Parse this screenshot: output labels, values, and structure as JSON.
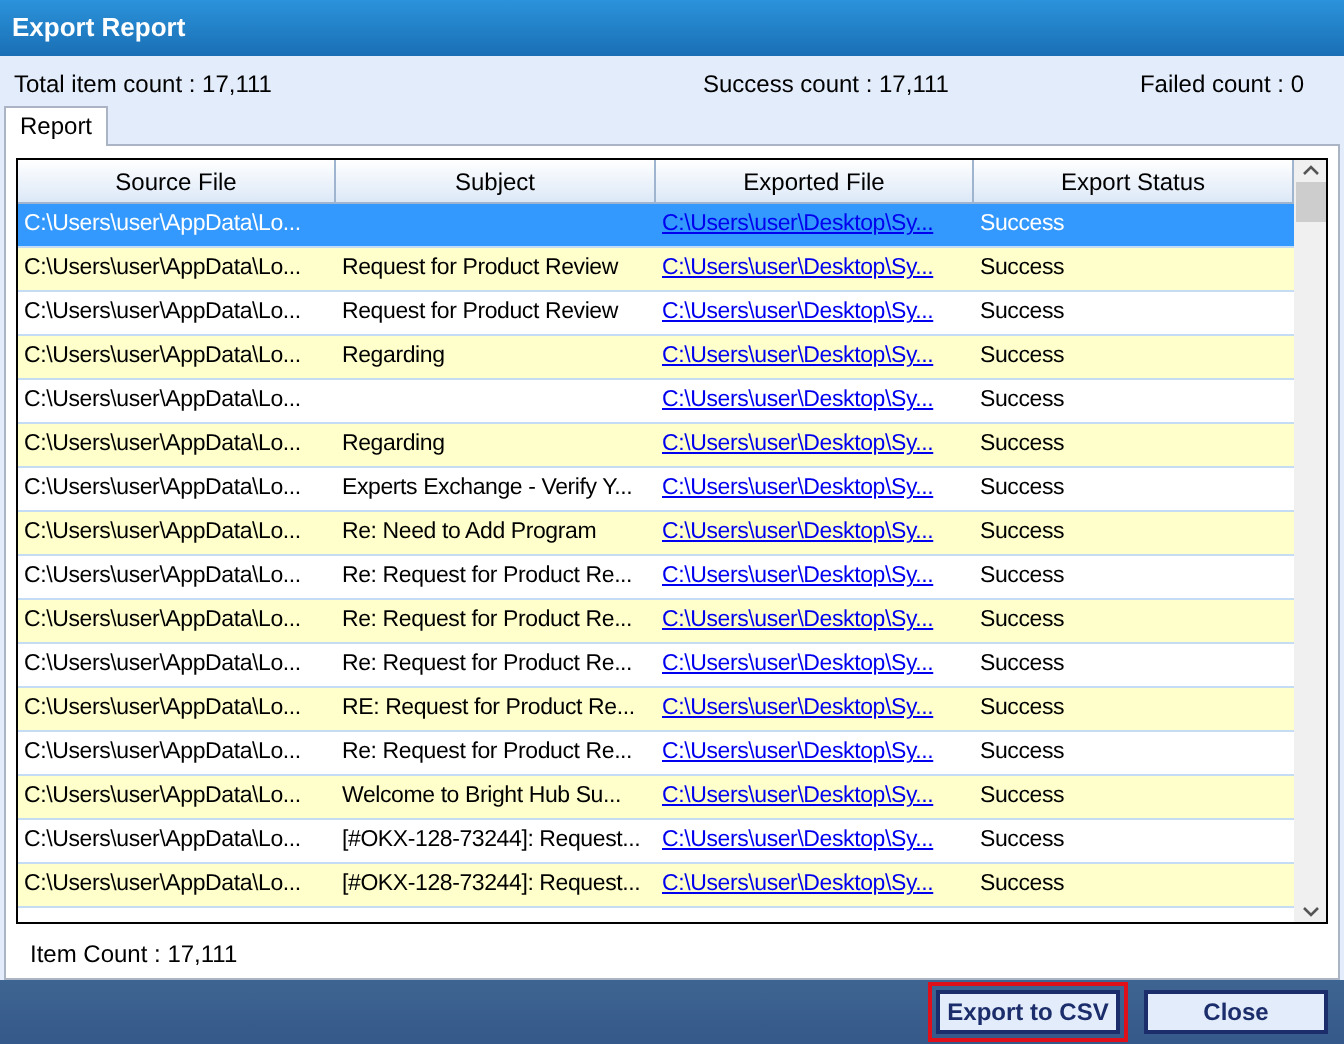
{
  "window": {
    "title": "Export Report"
  },
  "summary": {
    "total": "Total item count : 17,111",
    "success": "Success count :  17,111",
    "failed": "Failed count : 0"
  },
  "tabs": [
    {
      "label": "Report",
      "selected": true
    }
  ],
  "table": {
    "columns": [
      "Source File",
      "Subject",
      "Exported File",
      "Export Status"
    ],
    "rows": [
      {
        "source": "C:\\Users\\user\\AppData\\Lo...",
        "subject": "",
        "exported": "C:\\Users\\user\\Desktop\\Sy...",
        "status": "Success",
        "selected": true
      },
      {
        "source": "C:\\Users\\user\\AppData\\Lo...",
        "subject": "Request for Product Review",
        "exported": "C:\\Users\\user\\Desktop\\Sy...",
        "status": "Success",
        "selected": false
      },
      {
        "source": "C:\\Users\\user\\AppData\\Lo...",
        "subject": "Request for Product Review",
        "exported": "C:\\Users\\user\\Desktop\\Sy...",
        "status": "Success",
        "selected": false
      },
      {
        "source": "C:\\Users\\user\\AppData\\Lo...",
        "subject": "Regarding",
        "exported": "C:\\Users\\user\\Desktop\\Sy...",
        "status": "Success",
        "selected": false
      },
      {
        "source": "C:\\Users\\user\\AppData\\Lo...",
        "subject": "",
        "exported": "C:\\Users\\user\\Desktop\\Sy...",
        "status": "Success",
        "selected": false
      },
      {
        "source": "C:\\Users\\user\\AppData\\Lo...",
        "subject": "Regarding",
        "exported": "C:\\Users\\user\\Desktop\\Sy...",
        "status": "Success",
        "selected": false
      },
      {
        "source": "C:\\Users\\user\\AppData\\Lo...",
        "subject": "Experts Exchange - Verify Y...",
        "exported": "C:\\Users\\user\\Desktop\\Sy...",
        "status": "Success",
        "selected": false
      },
      {
        "source": "C:\\Users\\user\\AppData\\Lo...",
        "subject": "Re: Need to Add Program",
        "exported": "C:\\Users\\user\\Desktop\\Sy...",
        "status": "Success",
        "selected": false
      },
      {
        "source": "C:\\Users\\user\\AppData\\Lo...",
        "subject": "Re: Request for Product Re...",
        "exported": "C:\\Users\\user\\Desktop\\Sy...",
        "status": "Success",
        "selected": false
      },
      {
        "source": "C:\\Users\\user\\AppData\\Lo...",
        "subject": "Re: Request for Product Re...",
        "exported": "C:\\Users\\user\\Desktop\\Sy...",
        "status": "Success",
        "selected": false
      },
      {
        "source": "C:\\Users\\user\\AppData\\Lo...",
        "subject": "Re: Request for Product Re...",
        "exported": "C:\\Users\\user\\Desktop\\Sy...",
        "status": "Success",
        "selected": false
      },
      {
        "source": "C:\\Users\\user\\AppData\\Lo...",
        "subject": "RE: Request for Product Re...",
        "exported": "C:\\Users\\user\\Desktop\\Sy...",
        "status": "Success",
        "selected": false
      },
      {
        "source": "C:\\Users\\user\\AppData\\Lo...",
        "subject": "Re: Request for Product Re...",
        "exported": "C:\\Users\\user\\Desktop\\Sy...",
        "status": "Success",
        "selected": false
      },
      {
        "source": "C:\\Users\\user\\AppData\\Lo...",
        "subject": "Welcome to Bright Hub Su...",
        "exported": "C:\\Users\\user\\Desktop\\Sy...",
        "status": "Success",
        "selected": false
      },
      {
        "source": "C:\\Users\\user\\AppData\\Lo...",
        "subject": "[#OKX-128-73244]: Request...",
        "exported": "C:\\Users\\user\\Desktop\\Sy...",
        "status": "Success",
        "selected": false
      },
      {
        "source": "C:\\Users\\user\\AppData\\Lo...",
        "subject": "[#OKX-128-73244]: Request...",
        "exported": "C:\\Users\\user\\Desktop\\Sy...",
        "status": "Success",
        "selected": false
      }
    ]
  },
  "item_count": "Item Count : 17,111",
  "buttons": [
    {
      "label": "Export to CSV",
      "highlighted": true
    },
    {
      "label": "Close",
      "highlighted": false
    }
  ]
}
